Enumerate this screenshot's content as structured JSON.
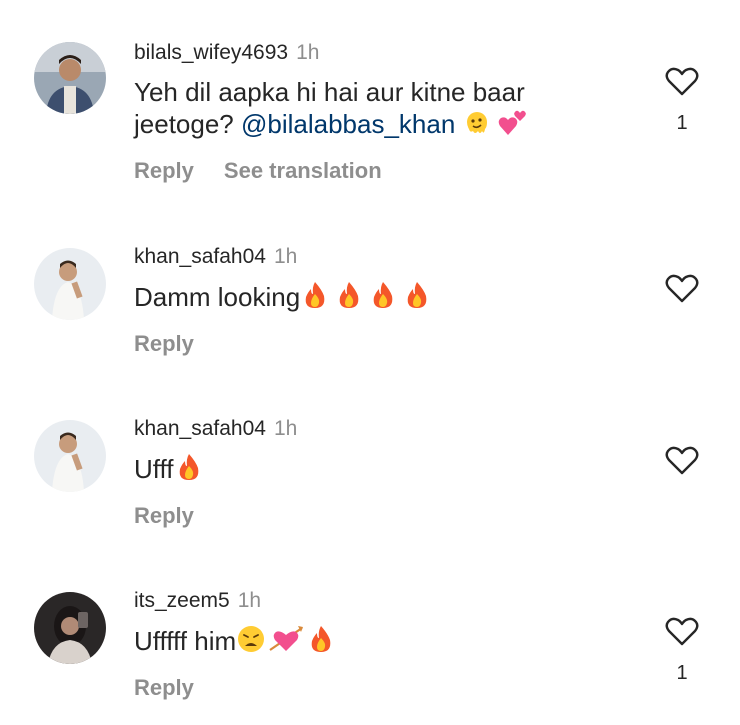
{
  "comments": [
    {
      "username": "bilals_wifey4693",
      "time": "1h",
      "text_line1": "Yeh dil aapka hi hai aur kitne baar",
      "text_line2": "jeetoge? ",
      "mention": "@bilalabbas_khan",
      "reply_label": "Reply",
      "translate_label": "See translation",
      "likes": "1"
    },
    {
      "username": "khan_safah04",
      "time": "1h",
      "text": "Damm looking",
      "reply_label": "Reply"
    },
    {
      "username": "khan_safah04",
      "time": "1h",
      "text": "Ufff",
      "reply_label": "Reply"
    },
    {
      "username": "its_zeem5",
      "time": "1h",
      "text": "Ufffff him",
      "reply_label": "Reply",
      "likes": "1"
    }
  ],
  "colors": {
    "text": "#262626",
    "secondary": "#8e8e8e",
    "mention": "#00376b"
  }
}
